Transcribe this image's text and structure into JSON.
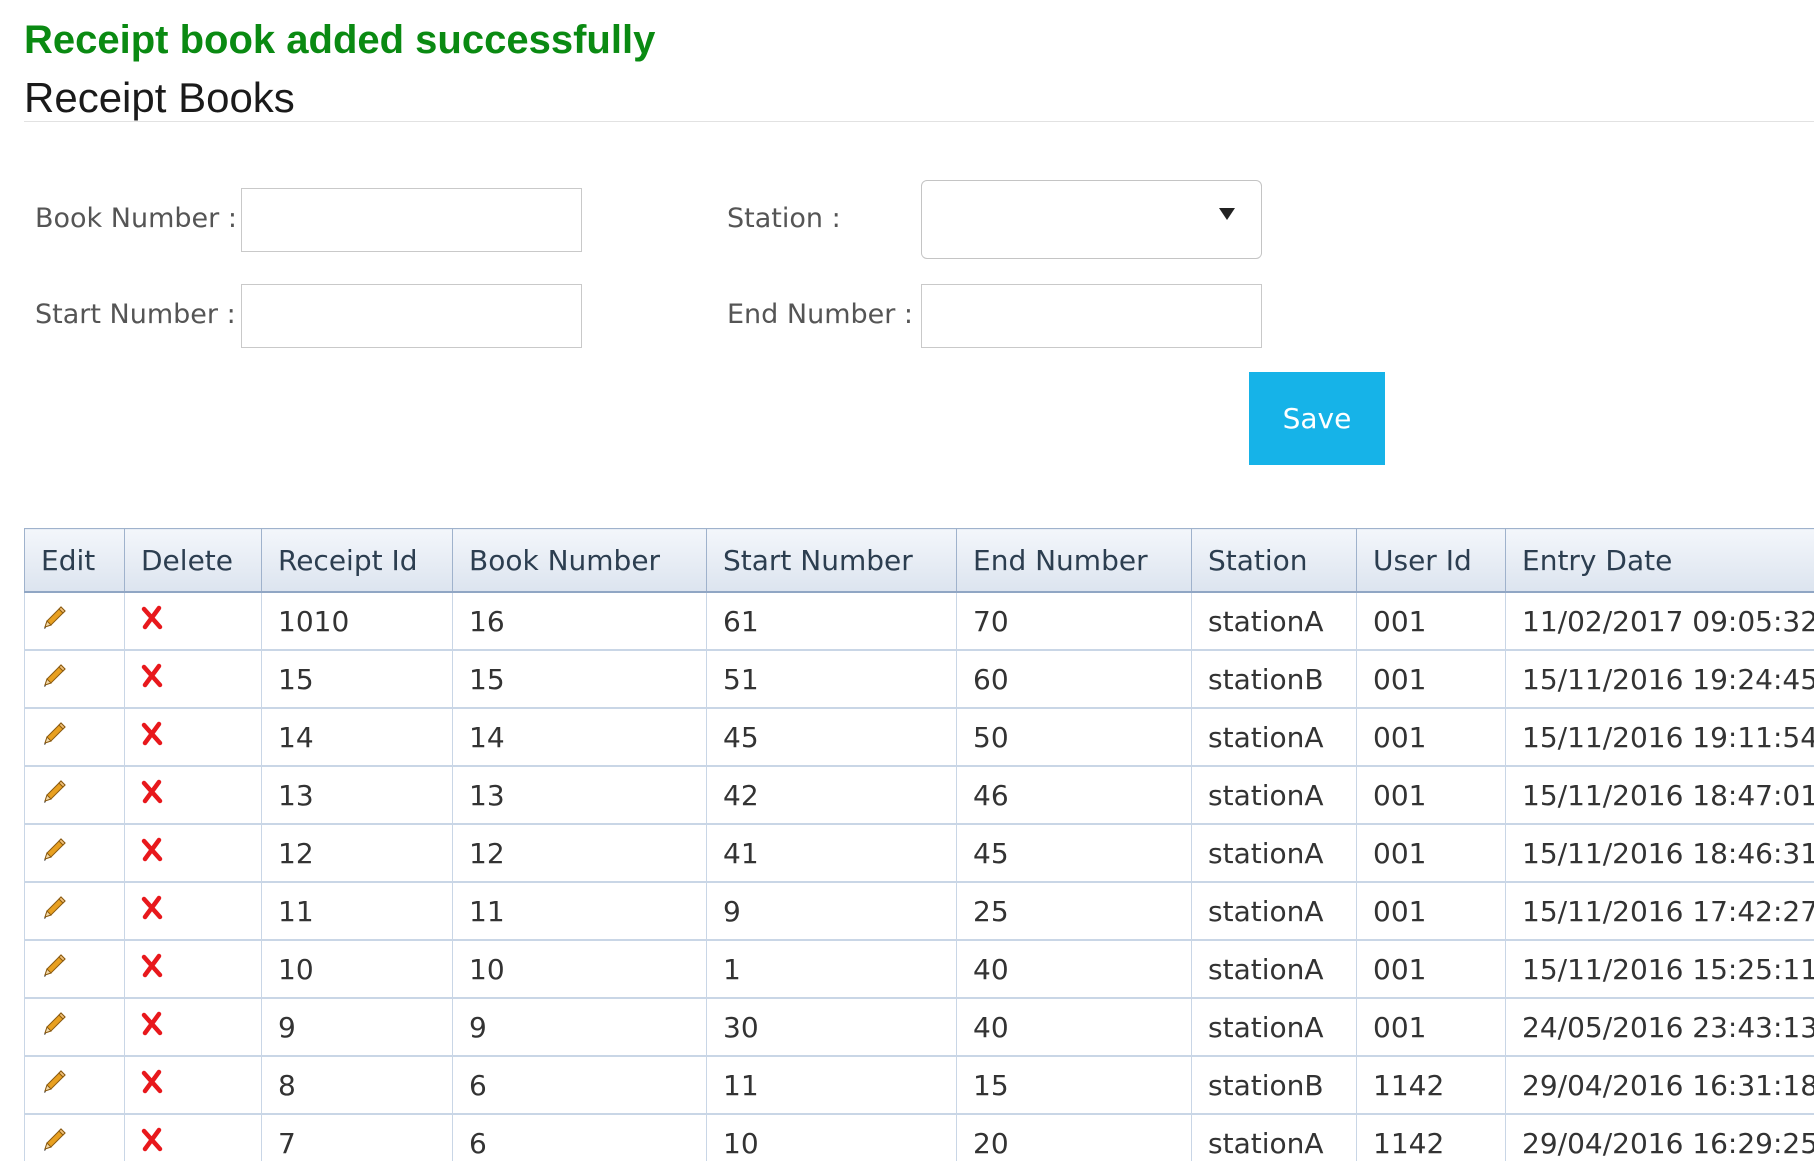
{
  "status": {
    "success_message": "Receipt book added successfully"
  },
  "page": {
    "title": "Receipt Books"
  },
  "form": {
    "book_number_label": "Book Number :",
    "book_number_value": "",
    "start_number_label": "Start Number :",
    "start_number_value": "",
    "station_label": "Station :",
    "station_selected": "",
    "end_number_label": "End Number :",
    "end_number_value": "",
    "save_label": "Save"
  },
  "table": {
    "headers": [
      "Edit",
      "Delete",
      "Receipt Id",
      "Book Number",
      "Start Number",
      "End Number",
      "Station",
      "User Id",
      "Entry Date"
    ],
    "rows": [
      {
        "receipt_id": "1010",
        "book_number": "16",
        "start_number": "61",
        "end_number": "70",
        "station": "stationA",
        "user_id": "001",
        "entry_date": "11/02/2017 09:05:32"
      },
      {
        "receipt_id": "15",
        "book_number": "15",
        "start_number": "51",
        "end_number": "60",
        "station": "stationB",
        "user_id": "001",
        "entry_date": "15/11/2016 19:24:45"
      },
      {
        "receipt_id": "14",
        "book_number": "14",
        "start_number": "45",
        "end_number": "50",
        "station": "stationA",
        "user_id": "001",
        "entry_date": "15/11/2016 19:11:54"
      },
      {
        "receipt_id": "13",
        "book_number": "13",
        "start_number": "42",
        "end_number": "46",
        "station": "stationA",
        "user_id": "001",
        "entry_date": "15/11/2016 18:47:01"
      },
      {
        "receipt_id": "12",
        "book_number": "12",
        "start_number": "41",
        "end_number": "45",
        "station": "stationA",
        "user_id": "001",
        "entry_date": "15/11/2016 18:46:31"
      },
      {
        "receipt_id": "11",
        "book_number": "11",
        "start_number": "9",
        "end_number": "25",
        "station": "stationA",
        "user_id": "001",
        "entry_date": "15/11/2016 17:42:27"
      },
      {
        "receipt_id": "10",
        "book_number": "10",
        "start_number": "1",
        "end_number": "40",
        "station": "stationA",
        "user_id": "001",
        "entry_date": "15/11/2016 15:25:11"
      },
      {
        "receipt_id": "9",
        "book_number": "9",
        "start_number": "30",
        "end_number": "40",
        "station": "stationA",
        "user_id": "001",
        "entry_date": "24/05/2016 23:43:13"
      },
      {
        "receipt_id": "8",
        "book_number": "6",
        "start_number": "11",
        "end_number": "15",
        "station": "stationB",
        "user_id": "1142",
        "entry_date": "29/04/2016 16:31:18"
      },
      {
        "receipt_id": "7",
        "book_number": "6",
        "start_number": "10",
        "end_number": "20",
        "station": "stationA",
        "user_id": "1142",
        "entry_date": "29/04/2016 16:29:25"
      }
    ]
  },
  "icons": {
    "edit": "pencil-icon",
    "delete": "red-x-icon",
    "select": "caret-down-icon"
  },
  "colors": {
    "success": "#0a8a12",
    "save_button": "#16b3e8",
    "delete_icon": "#e8181c"
  }
}
